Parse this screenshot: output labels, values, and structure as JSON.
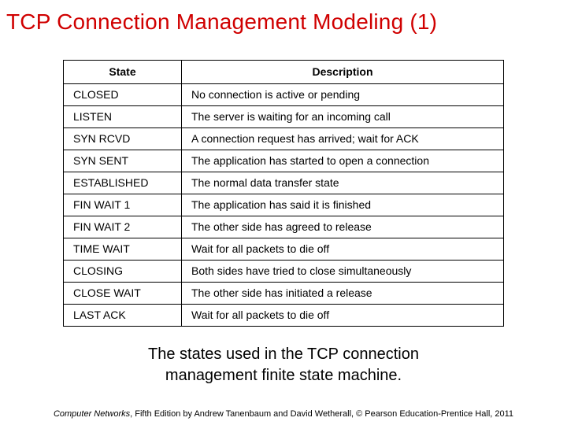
{
  "title": "TCP Connection Management Modeling (1)",
  "table": {
    "headers": {
      "state": "State",
      "description": "Description"
    },
    "rows": [
      {
        "state": "CLOSED",
        "description": "No connection is active or pending"
      },
      {
        "state": "LISTEN",
        "description": "The server is waiting for an incoming call"
      },
      {
        "state": "SYN RCVD",
        "description": "A connection request has arrived; wait for ACK"
      },
      {
        "state": "SYN SENT",
        "description": "The application has started to open a connection"
      },
      {
        "state": "ESTABLISHED",
        "description": "The normal data transfer state"
      },
      {
        "state": "FIN WAIT 1",
        "description": "The application has said it is finished"
      },
      {
        "state": "FIN WAIT 2",
        "description": "The other side has agreed to release"
      },
      {
        "state": "TIME WAIT",
        "description": "Wait for all packets to die off"
      },
      {
        "state": "CLOSING",
        "description": "Both sides have tried to close simultaneously"
      },
      {
        "state": "CLOSE WAIT",
        "description": "The other side has initiated a release"
      },
      {
        "state": "LAST ACK",
        "description": "Wait for all packets to die off"
      }
    ]
  },
  "caption_line1": "The states used in the TCP connection",
  "caption_line2": "management finite state machine.",
  "footer_italic": "Computer Networks",
  "footer_rest": ", Fifth Edition by Andrew Tanenbaum and David Wetherall, © Pearson Education-Prentice Hall, 2011"
}
